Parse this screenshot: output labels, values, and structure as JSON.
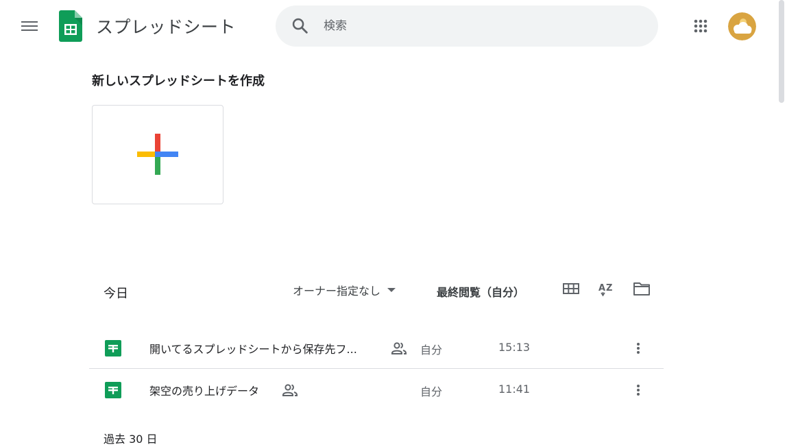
{
  "header": {
    "app_title": "スプレッドシート",
    "search_placeholder": "検索",
    "menu_icon": "hamburger-menu-icon",
    "apps_icon": "apps-grid-icon",
    "logo_icon": "sheets-logo-icon"
  },
  "template_section": {
    "title": "新しいスプレッドシートを作成",
    "blank_icon": "multicolor-plus-icon"
  },
  "toolbar": {
    "section_today": "今日",
    "owner_filter": "オーナー指定なし",
    "sort_label": "最終閲覧（自分）",
    "grid_view_icon": "grid-view-icon",
    "sort_az_icon": "sort-az-icon",
    "folder_icon": "folder-picker-icon"
  },
  "files": [
    {
      "name": "開いてるスプレッドシートから保存先フ...",
      "shared": true,
      "owner": "自分",
      "time": "15:13"
    },
    {
      "name": "架空の売り上げデータ",
      "shared": true,
      "owner": "自分",
      "time": "11:41"
    }
  ],
  "section_past": "過去 30 日",
  "colors": {
    "sheets_green": "#0f9d58",
    "plus_red": "#ea4335",
    "plus_blue": "#4285f4",
    "plus_green": "#34a853",
    "plus_yellow": "#fbbc04",
    "search_bg": "#f1f3f4",
    "avatar_bg": "#d9a441"
  }
}
